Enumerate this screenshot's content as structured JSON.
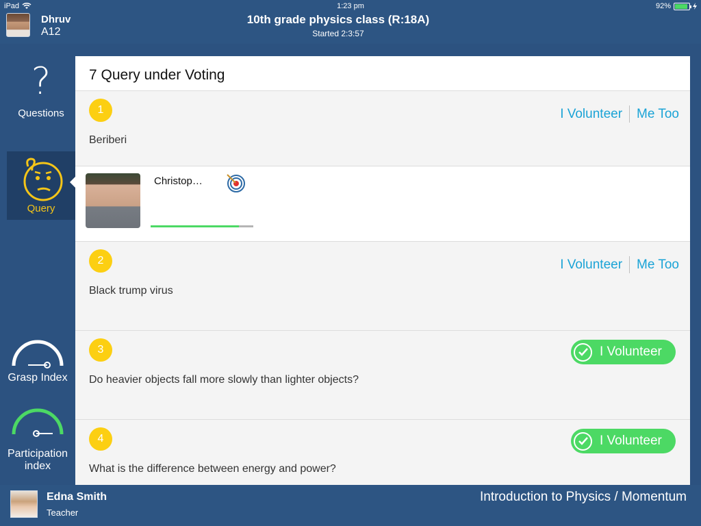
{
  "status_bar": {
    "device": "iPad",
    "time": "1:23 pm",
    "battery": "92%"
  },
  "header": {
    "user_name": "Dhruv",
    "user_id": "A12",
    "class_title": "10th grade physics class (R:18A)",
    "started": "Started 2:3:57"
  },
  "sidebar": {
    "questions_label": "Questions",
    "query_label": "Query",
    "grasp_label": "Grasp Index",
    "participation_label_1": "Participation",
    "participation_label_2": "index"
  },
  "panel": {
    "title": "7 Query under Voting",
    "queries": [
      {
        "number": "1",
        "text": "Beriberi",
        "volunteer": "I Volunteer",
        "me_too": "Me Too"
      },
      {
        "number": "2",
        "text": "Black trump virus",
        "volunteer": "I Volunteer",
        "me_too": "Me Too"
      },
      {
        "number": "3",
        "text": "Do heavier objects fall more slowly than lighter objects?",
        "volunteer": "I Volunteer"
      },
      {
        "number": "4",
        "text": "What is the difference between energy and power?",
        "volunteer": "I Volunteer"
      }
    ],
    "volunteer": {
      "name": "Christop…",
      "progress": 0.86
    }
  },
  "footer": {
    "teacher_name": "Edna Smith",
    "teacher_role": "Teacher",
    "breadcrumb": "Introduction to Physics / Momentum"
  },
  "colors": {
    "accent": "#1aa3d6",
    "badge": "#fccf12",
    "success": "#4cd964",
    "navy": "#2d5583"
  }
}
